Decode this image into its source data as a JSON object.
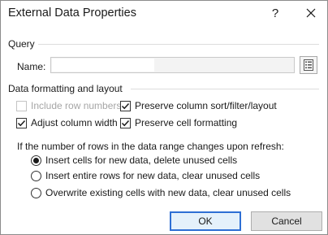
{
  "window": {
    "title": "External Data Properties",
    "help_glyph": "?",
    "close_glyph": "✕"
  },
  "query": {
    "section_label": "Query",
    "name_label": "Name:",
    "name_value": ""
  },
  "formatting": {
    "section_label": "Data formatting and layout",
    "include_row_numbers": {
      "label": "Include row numbers",
      "checked": false,
      "enabled": false
    },
    "preserve_column_sort": {
      "label": "Preserve column sort/filter/layout",
      "checked": true,
      "enabled": true
    },
    "adjust_column_width": {
      "label": "Adjust column width",
      "checked": true,
      "enabled": true
    },
    "preserve_cell_formatting": {
      "label": "Preserve cell formatting",
      "checked": true,
      "enabled": true
    }
  },
  "refresh": {
    "question": "If the number of rows in the data range changes upon refresh:",
    "options": [
      {
        "label": "Insert cells for new data, delete unused cells",
        "selected": true
      },
      {
        "label": "Insert entire rows for new data, clear unused cells",
        "selected": false
      },
      {
        "label": "Overwrite existing cells with new data, clear unused cells",
        "selected": false
      }
    ]
  },
  "buttons": {
    "ok": "OK",
    "cancel": "Cancel"
  },
  "colors": {
    "accent": "#2e6fd4",
    "disabled_text": "#a6a6a6"
  }
}
